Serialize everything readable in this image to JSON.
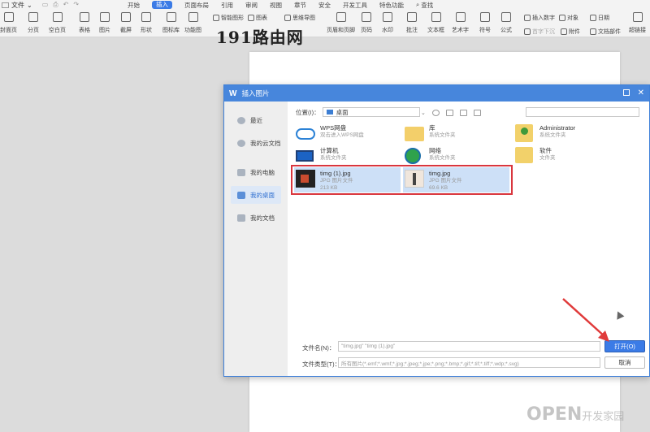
{
  "menu": {
    "file_label": "文件",
    "tabs": [
      "开始",
      "插入",
      "页面布局",
      "引用",
      "审阅",
      "视图",
      "章节",
      "安全",
      "开发工具",
      "特色功能"
    ],
    "active_tab": "插入",
    "search_label": "查找"
  },
  "ribbon": {
    "big_buttons": [
      "封面页",
      "分页",
      "空白页",
      "表格",
      "图片",
      "截屏",
      "形状",
      "图标库",
      "功能图",
      "页眉和页脚",
      "页码",
      "水印",
      "批注",
      "文本框",
      "艺术字",
      "符号",
      "公式",
      "超链接"
    ],
    "small_buttons": [
      "智能图形",
      "图表",
      "思维导图",
      "插入数字",
      "对象",
      "日期",
      "首字下沉",
      "附件",
      "文档部件"
    ]
  },
  "watermark_top": "191路由网",
  "dialog": {
    "title": "插入图片",
    "logo": "W",
    "sidebar": [
      "最近",
      "我的云文档",
      "我的电脑",
      "我的桌面",
      "我的文档"
    ],
    "sidebar_active": "我的桌面",
    "location_label": "位置(I)：",
    "location_value": "桌面",
    "items": [
      {
        "name": "WPS网盘",
        "desc": "双击进入WPS网盘",
        "icon": "cloud-icon"
      },
      {
        "name": "库",
        "desc": "系统文件夹",
        "icon": "folder-icon"
      },
      {
        "name": "Administrator",
        "desc": "系统文件夹",
        "icon": "user-folder-icon"
      },
      {
        "name": "计算机",
        "desc": "系统文件夹",
        "icon": "computer-icon"
      },
      {
        "name": "网络",
        "desc": "系统文件夹",
        "icon": "network-icon"
      },
      {
        "name": "软件",
        "desc": "文件夹",
        "icon": "folder-icon"
      },
      {
        "name": "timg (1).jpg",
        "desc": "JPG 图片文件",
        "size": "213 KB",
        "icon": "image-thumbnail"
      },
      {
        "name": "timg.jpg",
        "desc": "JPG 图片文件",
        "size": "69.6 KB",
        "icon": "image-thumbnail"
      }
    ],
    "filename_label": "文件名(N)：",
    "filename_value": "\"timg.jpg\" \"timg (1).jpg\"",
    "filetype_label": "文件类型(T)：",
    "filetype_value": "所有图片(*.emf;*.wmf;*.jpg;*.jpeg;*.jpe;*.png;*.bmp;*.gif;*.tif;*.tiff;*.wdp;*.svg)",
    "open_button": "打开(O)",
    "cancel_button": "取消"
  },
  "watermark_bottom": {
    "big": "OPEN",
    "small": "开发家园"
  },
  "colors": {
    "accent": "#3b7be6",
    "title_bar": "#4786dc",
    "highlight": "#d9363e",
    "arrow": "#e03a3a"
  }
}
